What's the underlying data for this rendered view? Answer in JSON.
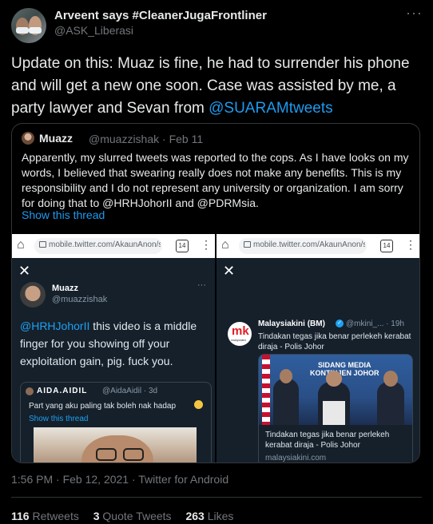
{
  "author": {
    "name": "Arveent says #CleanerJugaFrontliner",
    "handle": "@ASK_Liberasi",
    "avatar_icon": "avatar-photo",
    "more": "···"
  },
  "tweet": {
    "text_before": "Update on this: Muaz is fine, he had to surrender his phone and will get a new one soon. Case was assisted by me, a party lawyer and Sevan from ",
    "mention": "@SUARAMtweets"
  },
  "quote": {
    "name": "Muazz",
    "handle": "@muazzishak · Feb 11",
    "text": "Apparently, my slurred tweets was reported to the cops. As I have looks on my words, I believed that swearing really does not make any benefits. This is my responsibility and I do not represent any university or organization. I am sorry for doing that to @HRHJohorII and @PDRMsia.",
    "show_thread": "Show this thread"
  },
  "screenshot1": {
    "url": "mobile.twitter.com/AkaunAnon/s",
    "tab_count": "14",
    "close": "✕",
    "name": "Muazz",
    "handle": "@muazzishak",
    "more": "···",
    "mention": "@HRHJohorII",
    "text": " this video is a middle finger for you showing off your exploitation gain, pig. fuck you.",
    "inner_name": "AIDA.AIDIL",
    "inner_handle": "@AidaAidil · 3d",
    "inner_text": "Part yang aku paling tak boleh nak hadap",
    "inner_thread": "Show this thread"
  },
  "screenshot2": {
    "url": "mobile.twitter.com/AkaunAnon/s",
    "tab_count": "14",
    "close": "✕",
    "logo_letters": "mk",
    "logo_sub": "malaysiakini",
    "name": "Malaysiakini (BM)",
    "verified": "✓",
    "handle": "@mkini_... · 19h",
    "text": "Tindakan tegas jika benar perlekeh kerabat diraja - Polis Johor",
    "sign": "SIDANG MEDIA\nKONTINJEN JOHOR",
    "card_title": "Tindakan tegas jika benar perlekeh kerabat diraja - Polis Johor",
    "card_url": "malaysiakini.com"
  },
  "meta": "1:56 PM · Feb 12, 2021 · Twitter for Android",
  "stats": {
    "retweets_count": "116",
    "retweets_label": "Retweets",
    "quotes_count": "3",
    "quotes_label": "Quote Tweets",
    "likes_count": "263",
    "likes_label": "Likes"
  }
}
